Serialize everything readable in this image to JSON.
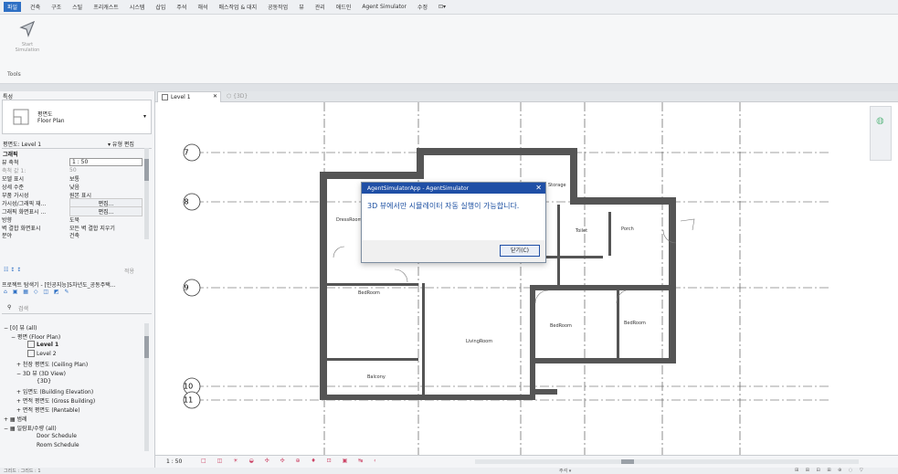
{
  "menubar": {
    "items": [
      "파일",
      "건축",
      "구조",
      "스틸",
      "프리캐스트",
      "시스템",
      "삽입",
      "주석",
      "해석",
      "매스작업 & 대지",
      "공동작업",
      "뷰",
      "관리",
      "애드인",
      "Agent Simulator",
      "수정"
    ],
    "extra": "⊡▾"
  },
  "ribbon": {
    "button_label": "Start Simulation",
    "panel": "Tools"
  },
  "properties": {
    "title": "특성",
    "type_line1": "평면도",
    "type_line2": "Floor Plan",
    "view_selector": "평면도: Level 1",
    "edit_type": "유형 편집",
    "section": "그래픽",
    "rows": [
      {
        "k": "뷰 축척",
        "v": "1 : 50"
      },
      {
        "k": "축척 값   1:",
        "v": "50"
      },
      {
        "k": "모델 표시",
        "v": "보통"
      },
      {
        "k": "상세 수준",
        "v": "낮음"
      },
      {
        "k": "부품 가시성",
        "v": "원본 표시"
      },
      {
        "k": "가시성/그래픽 재...",
        "v": "편집..."
      },
      {
        "k": "그래픽 화면표시 ...",
        "v": "편집..."
      },
      {
        "k": "방향",
        "v": "도북"
      },
      {
        "k": "벽 결합 화면표시",
        "v": "모든 벽 결합 지우기"
      },
      {
        "k": "분야",
        "v": "건축"
      }
    ],
    "apply": "적용"
  },
  "browser": {
    "title": "프로젝트 탐색기 - [인공지능]5차년도_공동주택...",
    "search_placeholder": "검색",
    "items": [
      {
        "t": "− [0] 뷰 (all)",
        "x": 4
      },
      {
        "t": "− 평면 (Floor Plan)",
        "x": 12
      },
      {
        "t": "Level 1",
        "x": 40,
        "bold": true
      },
      {
        "t": "Level 2",
        "x": 40
      },
      {
        "t": "+ 천장 평면도 (Ceiling Plan)",
        "x": 18
      },
      {
        "t": "− 3D 뷰 (3D View)",
        "x": 18
      },
      {
        "t": "{3D}",
        "x": 40
      },
      {
        "t": "+ 입면도 (Building Elevation)",
        "x": 18
      },
      {
        "t": "+ 면적 평면도 (Gross Building)",
        "x": 18
      },
      {
        "t": "+ 면적 평면도 (Rentable)",
        "x": 18
      },
      {
        "t": "+ ▦ 범례",
        "x": 4
      },
      {
        "t": "− ▦ 일람표/수량 (all)",
        "x": 4
      },
      {
        "t": "Door Schedule",
        "x": 40
      },
      {
        "t": "Room Schedule",
        "x": 40
      }
    ]
  },
  "tabs": {
    "active": "Level 1",
    "other": "{3D}"
  },
  "plan": {
    "grids": [
      "7",
      "8",
      "9",
      "10",
      "11"
    ],
    "rooms": [
      "Storage",
      "DressRoom",
      "Toilet",
      "Porch",
      "BedRoom",
      "BedRoom",
      "BedRoom",
      "LivingRoom",
      "Balcony"
    ]
  },
  "statusbar": {
    "scale": "1 : 50"
  },
  "bottombar": {
    "left": "그리드 : 그리드 : 1",
    "right": "주석 ▾"
  },
  "dialog": {
    "title": "AgentSimulatorApp - AgentSimulator",
    "message": "3D 뷰에서만 시뮬레이터 자동 실행이 가능합니다.",
    "button": "닫기(C)"
  }
}
